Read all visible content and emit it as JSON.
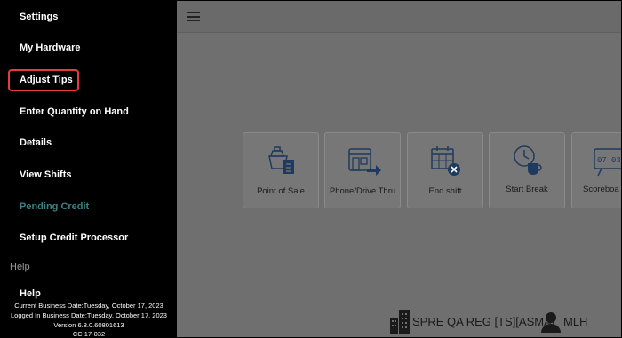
{
  "sidebar": {
    "items": [
      {
        "label": "Settings"
      },
      {
        "label": "My Hardware"
      },
      {
        "label": "Adjust Tips"
      },
      {
        "label": "Enter Quantity on Hand"
      },
      {
        "label": "Details"
      },
      {
        "label": "View Shifts"
      },
      {
        "label": "Pending Credit"
      },
      {
        "label": "Setup Credit Processor"
      }
    ],
    "help_section": "Help",
    "help_item": "Help",
    "footer": {
      "current_business_date": "Current Business Date:Tuesday, October 17, 2023",
      "logged_in_business_date": "Logged In Business Date:Tuesday, October 17, 2023",
      "version": "Version 6.8.0.60801613",
      "cc": "CC 17-032"
    }
  },
  "tiles": [
    {
      "label": "Point of Sale",
      "icon": "point-of-sale-icon"
    },
    {
      "label": "Phone/Drive Thru",
      "icon": "phone-drive-thru-icon"
    },
    {
      "label": "End shift",
      "icon": "end-shift-icon"
    },
    {
      "label": "Start Break",
      "icon": "start-break-icon"
    },
    {
      "label": "Scoreboa",
      "icon": "scoreboard-icon"
    }
  ],
  "status": {
    "store": "SPRE QA REG [TS][ASMA]",
    "user": "MLH"
  },
  "colors": {
    "highlight": "#e53b3b",
    "disabled_item": "#3f7f83",
    "icon_blue": "#1f3a5f"
  }
}
